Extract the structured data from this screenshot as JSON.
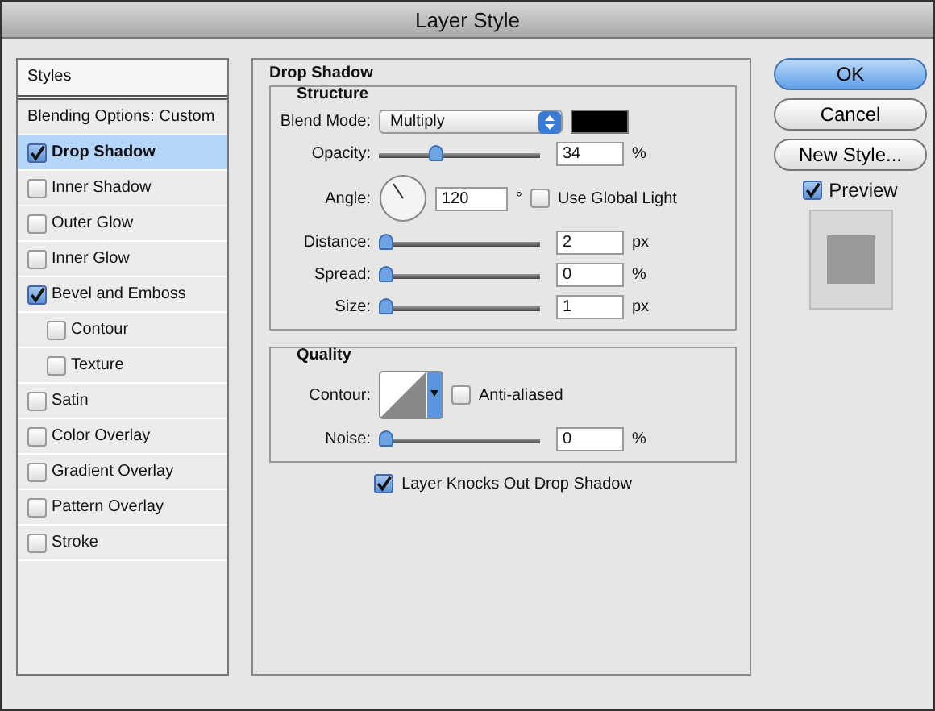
{
  "window": {
    "title": "Layer Style"
  },
  "styles_panel": {
    "header": "Styles",
    "blending_options": "Blending Options: Custom",
    "effects": [
      {
        "label": "Drop Shadow",
        "checked": true,
        "selected": true
      },
      {
        "label": "Inner Shadow",
        "checked": false,
        "selected": false
      },
      {
        "label": "Outer Glow",
        "checked": false,
        "selected": false
      },
      {
        "label": "Inner Glow",
        "checked": false,
        "selected": false
      },
      {
        "label": "Bevel and Emboss",
        "checked": true,
        "selected": false,
        "children": [
          {
            "label": "Contour",
            "checked": false,
            "selected": false
          },
          {
            "label": "Texture",
            "checked": false,
            "selected": false
          }
        ]
      },
      {
        "label": "Satin",
        "checked": false,
        "selected": false
      },
      {
        "label": "Color Overlay",
        "checked": false,
        "selected": false
      },
      {
        "label": "Gradient Overlay",
        "checked": false,
        "selected": false
      },
      {
        "label": "Pattern Overlay",
        "checked": false,
        "selected": false
      },
      {
        "label": "Stroke",
        "checked": false,
        "selected": false
      }
    ]
  },
  "settings": {
    "title": "Drop Shadow",
    "structure": {
      "title": "Structure",
      "blend_mode": {
        "label": "Blend Mode:",
        "value": "Multiply"
      },
      "opacity": {
        "label": "Opacity:",
        "level": 0.34,
        "value": "34",
        "unit": "%"
      },
      "angle": {
        "label": "Angle:",
        "value": "120",
        "unit": "°",
        "global_light": {
          "label": "Use Global Light",
          "checked": false
        }
      },
      "distance": {
        "label": "Distance:",
        "level": 0,
        "value": "2",
        "unit": "px"
      },
      "spread": {
        "label": "Spread:",
        "level": 0,
        "value": "0",
        "unit": "%"
      },
      "size": {
        "label": "Size:",
        "level": 0,
        "value": "1",
        "unit": "px"
      }
    },
    "quality": {
      "title": "Quality",
      "contour": {
        "label": "Contour:"
      },
      "anti_aliased": {
        "label": "Anti-aliased",
        "checked": false
      },
      "noise": {
        "label": "Noise:",
        "level": 0,
        "value": "0",
        "unit": "%"
      }
    },
    "knockout": {
      "label": "Layer Knocks Out Drop Shadow",
      "checked": true
    }
  },
  "buttons": [
    {
      "label": "OK",
      "default": true
    },
    {
      "label": "Cancel",
      "default": false
    },
    {
      "label": "New Style...",
      "default": false
    }
  ],
  "preview": {
    "label": "Preview",
    "checked": true
  }
}
